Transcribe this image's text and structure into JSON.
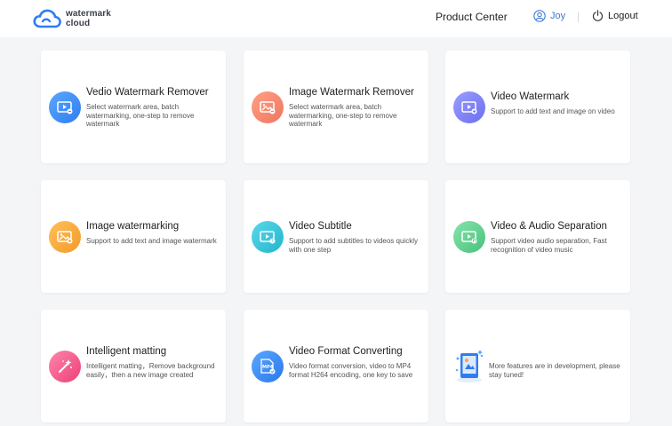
{
  "header": {
    "logo_line1": "watermark",
    "logo_line2": "cloud",
    "product_center": "Product Center",
    "username": "Joy",
    "logout": "Logout"
  },
  "tools": [
    {
      "title": "Vedio Watermark Remover",
      "desc": "Select watermark area, batch watermarking, one-step to remove watermark",
      "icon": "video-remove-icon",
      "color": "#3f8ef0"
    },
    {
      "title": "Image Watermark Remover",
      "desc": "Select watermark area, batch watermarking, one-step to remove watermark",
      "icon": "image-remove-icon",
      "color": "#f0846a"
    },
    {
      "title": "Video Watermark",
      "desc": "Support to add text and image on video",
      "icon": "video-watermark-icon",
      "color": "#7b7ef0"
    },
    {
      "title": "Image watermarking",
      "desc": "Support to add text and image watermark",
      "icon": "image-watermark-icon",
      "color": "#f5a83a"
    },
    {
      "title": "Video Subtitle",
      "desc": "Support to add subtitles to videos quickly with one step",
      "icon": "video-subtitle-icon",
      "color": "#2fc2d8"
    },
    {
      "title": "Video & Audio Separation",
      "desc": "Support video audio separation, Fast recognition of video music",
      "icon": "audio-separation-icon",
      "color": "#5fd08e"
    },
    {
      "title": "Intelligent matting",
      "desc": "Intelligent matting，Remove background easily，then a new image created",
      "icon": "magic-wand-icon",
      "color": "#f2558a"
    },
    {
      "title": "Video Format Converting",
      "desc": "Video format conversion, video to MP4 format H264 encoding, one key to save",
      "icon": "mp4-format-icon",
      "color": "#3d8ff0",
      "icon_text": "MP4"
    }
  ],
  "coming_soon": {
    "text": "More features are in development, please stay tuned!"
  }
}
